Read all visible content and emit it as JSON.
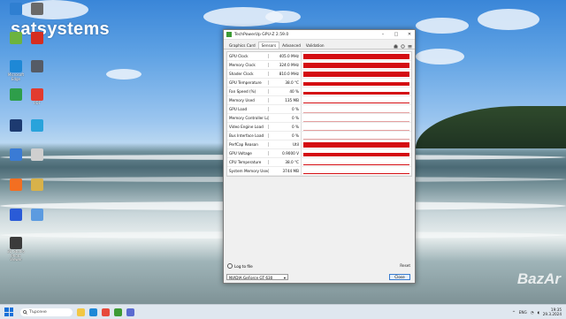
{
  "watermark": "satsystems",
  "watermark_bottom": "BazAr",
  "desktop_icons": [
    {
      "label": "",
      "color": "#2f7fd1"
    },
    {
      "label": "",
      "color": "#6a6a6a"
    },
    {
      "label": "",
      "color": "#6cb33f"
    },
    {
      "label": "",
      "color": "#d62d20"
    },
    {
      "label": "Microsoft\nEdge",
      "color": "#1e88d6"
    },
    {
      "label": "",
      "color": "#555b66"
    },
    {
      "label": "",
      "color": "#2e9e4a"
    },
    {
      "label": "PDF",
      "color": "#e23b2e"
    },
    {
      "label": "",
      "color": "#1d3a70"
    },
    {
      "label": "",
      "color": "#29a3db"
    },
    {
      "label": "",
      "color": "#3a7bd5"
    },
    {
      "label": "",
      "color": "#cfcfcf"
    },
    {
      "label": "",
      "color": "#f36f21"
    },
    {
      "label": "",
      "color": "#d8b24a"
    },
    {
      "label": "",
      "color": "#2a5bd7"
    },
    {
      "label": "",
      "color": "#5c9be0"
    },
    {
      "label": "3D Studio\nPhoto Viewer",
      "color": "#3b3b3b"
    }
  ],
  "window": {
    "title": "TechPowerUp GPU-Z 2.59.0",
    "tabs": [
      "Graphics Card",
      "Sensors",
      "Advanced",
      "Validation"
    ],
    "active_tab": "Sensors",
    "sensors": [
      {
        "label": "GPU Clock",
        "value": "405.0 MHz",
        "level": 0.8
      },
      {
        "label": "Memory Clock",
        "value": "324.0 MHz",
        "level": 0.8
      },
      {
        "label": "Shader Clock",
        "value": "810.0 MHz",
        "level": 0.8
      },
      {
        "label": "GPU Temperature",
        "value": "38.0 °C",
        "level": 0.55
      },
      {
        "label": "Fan Speed (%)",
        "value": "40 %",
        "level": 0.45
      },
      {
        "label": "Memory Used",
        "value": "135 MB",
        "level": 0.1
      },
      {
        "label": "GPU Load",
        "value": "0 %",
        "level": 0.0
      },
      {
        "label": "Memory Controller Load",
        "value": "0 %",
        "level": 0.0
      },
      {
        "label": "Video Engine Load",
        "value": "0 %",
        "level": 0.0
      },
      {
        "label": "Bus Interface Load",
        "value": "0 %",
        "level": 0.0
      },
      {
        "label": "PerfCap Reason",
        "value": "Util",
        "level": 0.9
      },
      {
        "label": "GPU Voltage",
        "value": "0.9000 V",
        "level": 0.6
      },
      {
        "label": "CPU Temperature",
        "value": "38.0 °C",
        "level": 0.15
      },
      {
        "label": "System Memory Used",
        "value": "3744 MB",
        "level": 0.2
      }
    ],
    "log_to_file": "Log to file",
    "reset": "Reset",
    "gpu_name": "NVIDIA GeForce GT 630",
    "close": "Close"
  },
  "taskbar": {
    "search_placeholder": "Търсене",
    "lang": "ENG",
    "time": "19:35",
    "date": "29.3.2024"
  },
  "colors": {
    "graph": "#d40d12",
    "accent": "#1570d8"
  }
}
